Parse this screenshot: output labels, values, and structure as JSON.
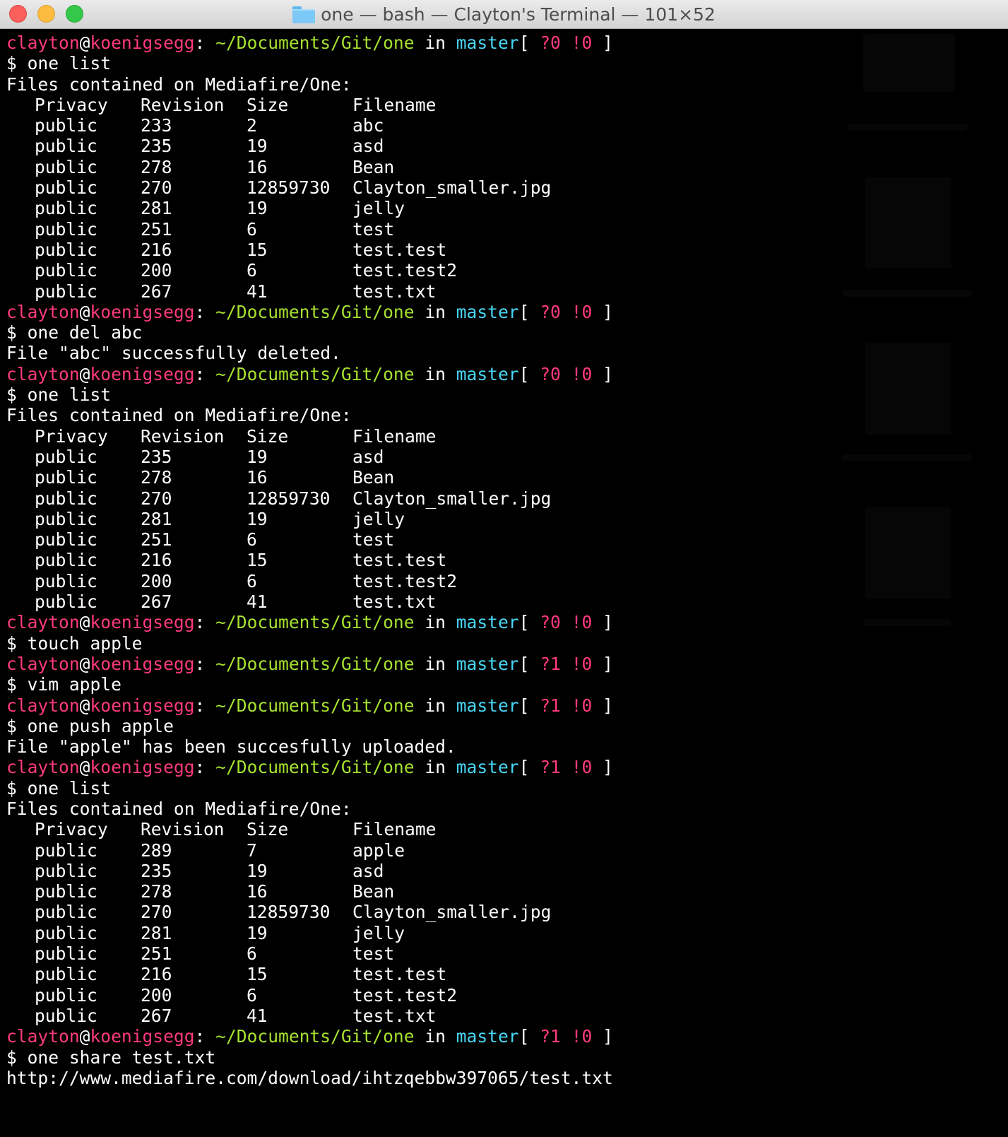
{
  "window": {
    "title": "one — bash — Clayton's Terminal — 101×52"
  },
  "prompt": {
    "user": "clayton",
    "at": "@",
    "host": "koenigsegg",
    "colon": ":",
    "path": "~/Documents/Git/one",
    "in": "in",
    "branch": "master",
    "open": "[",
    "close": "]"
  },
  "colors": {
    "user": "#ff3a7f",
    "path": "#a6e22e",
    "branch": "#48d6f4",
    "text": "#ffffff",
    "background": "#000000"
  },
  "headers": {
    "privacy": "Privacy",
    "revision": "Revision",
    "size": "Size",
    "filename": "Filename"
  },
  "blocks": [
    {
      "type": "prompt",
      "q": "?0",
      "e": "!0"
    },
    {
      "type": "cmd",
      "text": "$ one list"
    },
    {
      "type": "out",
      "text": "Files contained on Mediafire/One:"
    },
    {
      "type": "header"
    },
    {
      "type": "row",
      "privacy": "public",
      "revision": "233",
      "size": "2",
      "filename": "abc"
    },
    {
      "type": "row",
      "privacy": "public",
      "revision": "235",
      "size": "19",
      "filename": "asd"
    },
    {
      "type": "row",
      "privacy": "public",
      "revision": "278",
      "size": "16",
      "filename": "Bean"
    },
    {
      "type": "row",
      "privacy": "public",
      "revision": "270",
      "size": "12859730",
      "filename": "Clayton_smaller.jpg"
    },
    {
      "type": "row",
      "privacy": "public",
      "revision": "281",
      "size": "19",
      "filename": "jelly"
    },
    {
      "type": "row",
      "privacy": "public",
      "revision": "251",
      "size": "6",
      "filename": "test"
    },
    {
      "type": "row",
      "privacy": "public",
      "revision": "216",
      "size": "15",
      "filename": "test.test"
    },
    {
      "type": "row",
      "privacy": "public",
      "revision": "200",
      "size": "6",
      "filename": "test.test2"
    },
    {
      "type": "row",
      "privacy": "public",
      "revision": "267",
      "size": "41",
      "filename": "test.txt"
    },
    {
      "type": "prompt",
      "q": "?0",
      "e": "!0"
    },
    {
      "type": "cmd",
      "text": "$ one del abc"
    },
    {
      "type": "out",
      "text": "File \"abc\" successfully deleted."
    },
    {
      "type": "prompt",
      "q": "?0",
      "e": "!0"
    },
    {
      "type": "cmd",
      "text": "$ one list"
    },
    {
      "type": "out",
      "text": "Files contained on Mediafire/One:"
    },
    {
      "type": "header"
    },
    {
      "type": "row",
      "privacy": "public",
      "revision": "235",
      "size": "19",
      "filename": "asd"
    },
    {
      "type": "row",
      "privacy": "public",
      "revision": "278",
      "size": "16",
      "filename": "Bean"
    },
    {
      "type": "row",
      "privacy": "public",
      "revision": "270",
      "size": "12859730",
      "filename": "Clayton_smaller.jpg"
    },
    {
      "type": "row",
      "privacy": "public",
      "revision": "281",
      "size": "19",
      "filename": "jelly"
    },
    {
      "type": "row",
      "privacy": "public",
      "revision": "251",
      "size": "6",
      "filename": "test"
    },
    {
      "type": "row",
      "privacy": "public",
      "revision": "216",
      "size": "15",
      "filename": "test.test"
    },
    {
      "type": "row",
      "privacy": "public",
      "revision": "200",
      "size": "6",
      "filename": "test.test2"
    },
    {
      "type": "row",
      "privacy": "public",
      "revision": "267",
      "size": "41",
      "filename": "test.txt"
    },
    {
      "type": "prompt",
      "q": "?0",
      "e": "!0"
    },
    {
      "type": "cmd",
      "text": "$ touch apple"
    },
    {
      "type": "prompt",
      "q": "?1",
      "e": "!0"
    },
    {
      "type": "cmd",
      "text": "$ vim apple"
    },
    {
      "type": "prompt",
      "q": "?1",
      "e": "!0"
    },
    {
      "type": "cmd",
      "text": "$ one push apple"
    },
    {
      "type": "out",
      "text": "File \"apple\" has been succesfully uploaded."
    },
    {
      "type": "prompt",
      "q": "?1",
      "e": "!0"
    },
    {
      "type": "cmd",
      "text": "$ one list"
    },
    {
      "type": "out",
      "text": "Files contained on Mediafire/One:"
    },
    {
      "type": "header"
    },
    {
      "type": "row",
      "privacy": "public",
      "revision": "289",
      "size": "7",
      "filename": "apple"
    },
    {
      "type": "row",
      "privacy": "public",
      "revision": "235",
      "size": "19",
      "filename": "asd"
    },
    {
      "type": "row",
      "privacy": "public",
      "revision": "278",
      "size": "16",
      "filename": "Bean"
    },
    {
      "type": "row",
      "privacy": "public",
      "revision": "270",
      "size": "12859730",
      "filename": "Clayton_smaller.jpg"
    },
    {
      "type": "row",
      "privacy": "public",
      "revision": "281",
      "size": "19",
      "filename": "jelly"
    },
    {
      "type": "row",
      "privacy": "public",
      "revision": "251",
      "size": "6",
      "filename": "test"
    },
    {
      "type": "row",
      "privacy": "public",
      "revision": "216",
      "size": "15",
      "filename": "test.test"
    },
    {
      "type": "row",
      "privacy": "public",
      "revision": "200",
      "size": "6",
      "filename": "test.test2"
    },
    {
      "type": "row",
      "privacy": "public",
      "revision": "267",
      "size": "41",
      "filename": "test.txt"
    },
    {
      "type": "prompt",
      "q": "?1",
      "e": "!0"
    },
    {
      "type": "cmd",
      "text": "$ one share test.txt"
    },
    {
      "type": "out",
      "text": "http://www.mediafire.com/download/ihtzqebbw397065/test.txt"
    }
  ]
}
